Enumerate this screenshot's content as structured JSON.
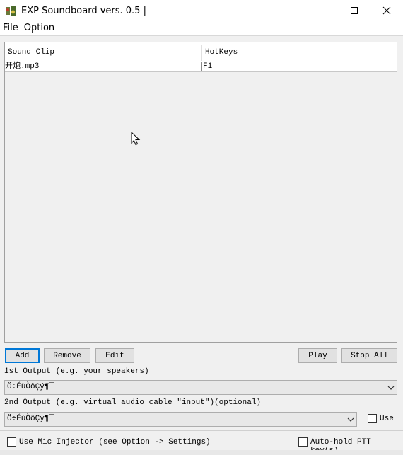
{
  "window": {
    "title": "EXP Soundboard vers. 0.5 |",
    "icon": "speaker-app-icon",
    "controls": [
      "minimize-icon",
      "maximize-icon",
      "close-icon"
    ]
  },
  "menu": {
    "items": [
      "File",
      "Option"
    ]
  },
  "list": {
    "columns": [
      "Sound Clip",
      "HotKeys"
    ],
    "rows": [
      {
        "clip": "开炮.mp3",
        "hotkey": "F1"
      }
    ]
  },
  "buttons": {
    "add": "Add",
    "remove": "Remove",
    "edit": "Edit",
    "play": "Play",
    "stop_all": "Stop All"
  },
  "output1": {
    "label": "1st Output (e.g. your speakers)",
    "value": "Ö÷ÉùÒôÇý¶¯"
  },
  "output2": {
    "label": "2nd Output (e.g. virtual audio cable \"input\")(optional)",
    "value": "Ö÷ÉùÒôÇý¶¯",
    "use_label": "Use"
  },
  "options": {
    "mic_injector_label": "Use Mic Injector (see Option -> Settings)",
    "auto_hold_label": "Auto-hold PTT key(s)"
  }
}
